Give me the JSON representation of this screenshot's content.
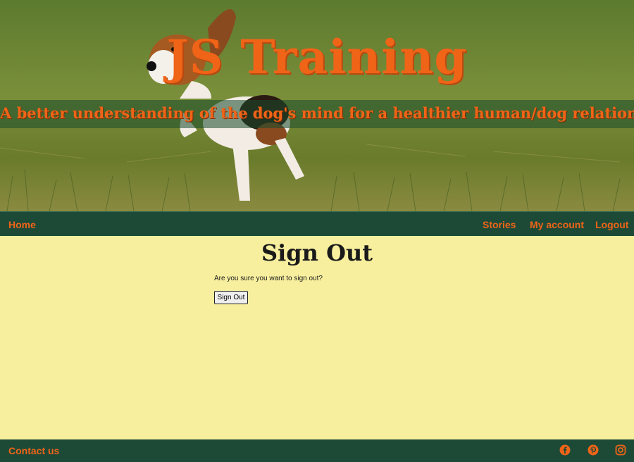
{
  "hero": {
    "title": "JS Training",
    "tagline": "A better understanding of the dog's mind for a healthier human/dog relationship"
  },
  "nav": {
    "home": "Home",
    "stories": "Stories",
    "my_account": "My account",
    "logout": "Logout"
  },
  "main": {
    "title": "Sign Out",
    "question": "Are you sure you want to sign out?",
    "button": "Sign Out"
  },
  "footer": {
    "contact": "Contact us",
    "icons": [
      "facebook-icon",
      "pinterest-icon",
      "instagram-icon"
    ]
  },
  "colors": {
    "accent": "#f06418",
    "dark_green": "#1d4a37",
    "page_bg": "#f7ef9e"
  }
}
